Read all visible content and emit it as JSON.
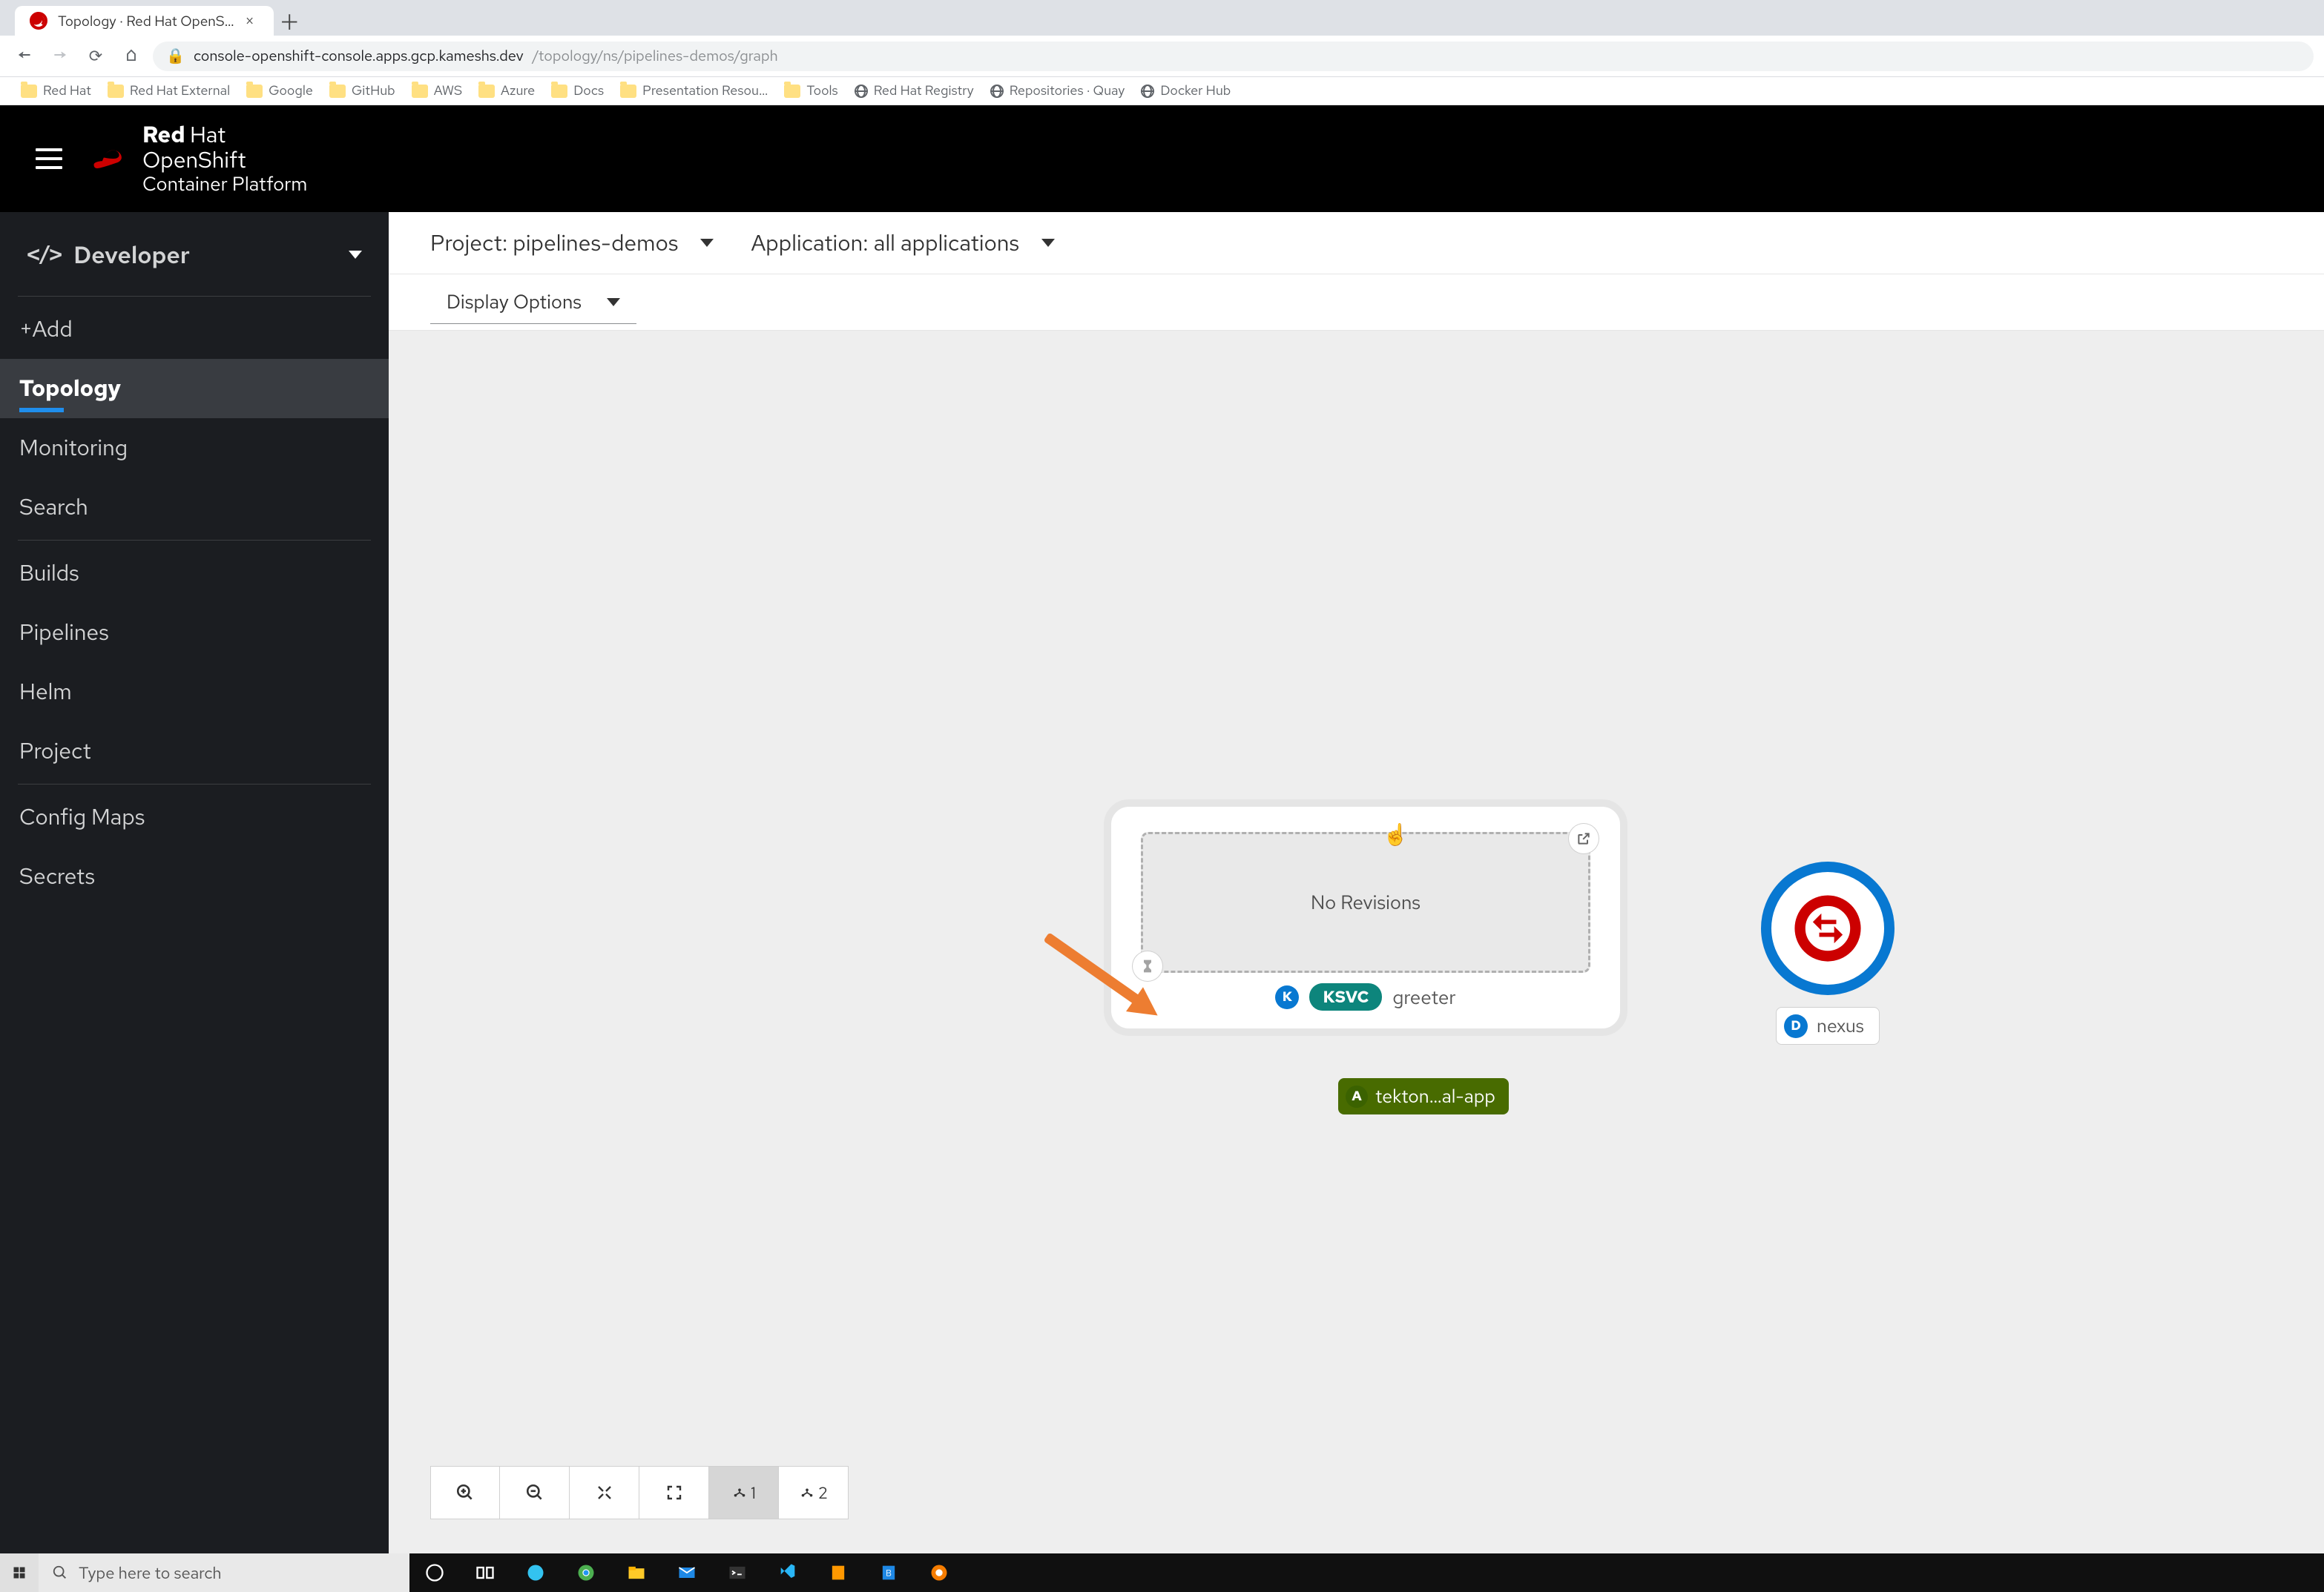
{
  "browser": {
    "tab_title": "Topology · Red Hat OpenShift C…",
    "url_host": "console-openshift-console.apps.gcp.kameshs.dev",
    "url_path": "/topology/ns/pipelines-demos/graph",
    "bookmarks": [
      {
        "label": "Red Hat",
        "icon": "folder"
      },
      {
        "label": "Red Hat External",
        "icon": "folder"
      },
      {
        "label": "Google",
        "icon": "folder"
      },
      {
        "label": "GitHub",
        "icon": "folder"
      },
      {
        "label": "AWS",
        "icon": "folder"
      },
      {
        "label": "Azure",
        "icon": "folder"
      },
      {
        "label": "Docs",
        "icon": "folder"
      },
      {
        "label": "Presentation Resou…",
        "icon": "folder"
      },
      {
        "label": "Tools",
        "icon": "folder"
      },
      {
        "label": "Red Hat Registry",
        "icon": "globe"
      },
      {
        "label": "Repositories · Quay",
        "icon": "globe"
      },
      {
        "label": "Docker Hub",
        "icon": "globe"
      }
    ]
  },
  "masthead": {
    "brand_l1a": "Red",
    "brand_l1b": "Hat",
    "brand_l2": "OpenShift",
    "brand_l3": "Container Platform"
  },
  "perspective": "Developer",
  "nav": [
    {
      "label": "+Add"
    },
    {
      "label": "Topology",
      "active": true
    },
    {
      "label": "Monitoring"
    },
    {
      "label": "Search"
    },
    {
      "divider": true
    },
    {
      "label": "Builds"
    },
    {
      "label": "Pipelines"
    },
    {
      "label": "Helm"
    },
    {
      "label": "Project"
    },
    {
      "divider": true
    },
    {
      "label": "Config Maps"
    },
    {
      "label": "Secrets"
    }
  ],
  "project_bar": {
    "project_prefix": "Project:",
    "project_name": "pipelines-demos",
    "application_prefix": "Application:",
    "application_name": "all applications"
  },
  "display_options_label": "Display Options",
  "canvas": {
    "ksvc": {
      "no_revisions": "No Revisions",
      "knative_badge": "K",
      "ksvc_pill": "KSVC",
      "service_name": "greeter"
    },
    "app_group": {
      "badge": "A",
      "label": "tekton…al-app"
    },
    "nexus": {
      "deployment_badge": "D",
      "name": "nexus"
    },
    "toolbar_counts": {
      "layout1": "1",
      "layout2": "2"
    }
  },
  "taskbar": {
    "search_placeholder": "Type here to search"
  }
}
